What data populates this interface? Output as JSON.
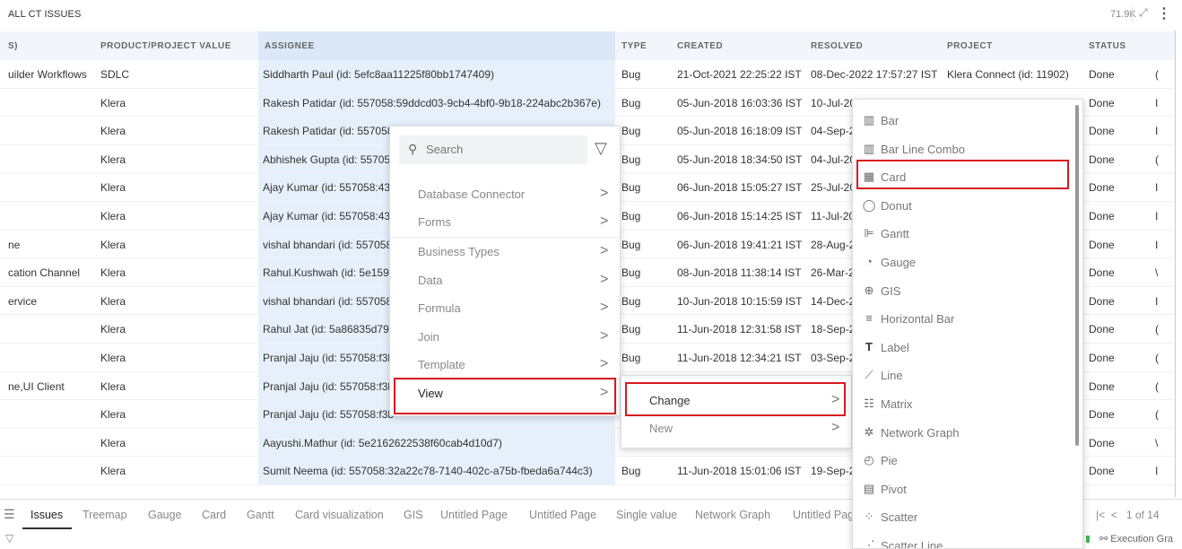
{
  "header": {
    "title": "ALL CT ISSUES",
    "count": "71.9K"
  },
  "table": {
    "columns": [
      "S)",
      "PRODUCT/PROJECT VALUE",
      "ASSIGNEE",
      "TYPE",
      "CREATED",
      "RESOLVED",
      "PROJECT",
      "STATUS"
    ],
    "rows": [
      [
        "uilder Workflows",
        "SDLC",
        "Siddharth Paul (id: 5efc8aa11225f80bb1747409)",
        "Bug",
        "21-Oct-2021 22:25:22 IST",
        "08-Dec-2022 17:57:27 IST",
        "Klera Connect (id: 11902)",
        "Done",
        "("
      ],
      [
        "",
        "Klera",
        "Rakesh Patidar (id: 557058:59ddcd03-9cb4-4bf0-9b18-224abc2b367e)",
        "Bug",
        "05-Jun-2018 16:03:36 IST",
        "10-Jul-20",
        "",
        "Done",
        "I"
      ],
      [
        "",
        "Klera",
        "Rakesh Patidar (id: 557058",
        "Bug",
        "05-Jun-2018 16:18:09 IST",
        "04-Sep-2",
        "",
        "Done",
        "I"
      ],
      [
        "",
        "Klera",
        "Abhishek Gupta (id: 55705",
        "Bug",
        "05-Jun-2018 18:34:50 IST",
        "04-Jul-20",
        "",
        "Done",
        "("
      ],
      [
        "",
        "Klera",
        "Ajay Kumar (id: 557058:43",
        "Bug",
        "06-Jun-2018 15:05:27 IST",
        "25-Jul-20",
        "",
        "Done",
        "I"
      ],
      [
        "",
        "Klera",
        "Ajay Kumar (id: 557058:43",
        "Bug",
        "06-Jun-2018 15:14:25 IST",
        "11-Jul-20",
        "",
        "Done",
        "I"
      ],
      [
        "ne",
        "Klera",
        "vishal bhandari (id: 557058",
        "Bug",
        "06-Jun-2018 19:41:21 IST",
        "28-Aug-2",
        "",
        "Done",
        "I"
      ],
      [
        "cation Channel",
        "Klera",
        "Rahul.Kushwah (id: 5e159c",
        "Bug",
        "08-Jun-2018 11:38:14 IST",
        "26-Mar-2",
        "",
        "Done",
        "\\"
      ],
      [
        "ervice",
        "Klera",
        "vishal bhandari (id: 557058",
        "Bug",
        "10-Jun-2018 10:15:59 IST",
        "14-Dec-2",
        "",
        "Done",
        "I"
      ],
      [
        "",
        "Klera",
        "Rahul Jat (id: 5a86835d79",
        "Bug",
        "11-Jun-2018 12:31:58 IST",
        "18-Sep-2",
        "",
        "Done",
        "("
      ],
      [
        "",
        "Klera",
        "Pranjal Jaju (id: 557058:f3b",
        "Bug",
        "11-Jun-2018 12:34:21 IST",
        "03-Sep-2",
        "",
        "Done",
        "("
      ],
      [
        "ne,UI Client",
        "Klera",
        "Pranjal Jaju (id: 557058:f3b",
        "",
        "",
        "",
        "",
        "Done",
        "("
      ],
      [
        "",
        "Klera",
        "Pranjal Jaju (id: 557058:f3b",
        "",
        "",
        "",
        "",
        "Done",
        "("
      ],
      [
        "",
        "Klera",
        "Aayushi.Mathur (id: 5e2162622538f60cab4d10d7)",
        "",
        "",
        "",
        "",
        "Done",
        "\\"
      ],
      [
        "",
        "Klera",
        "Sumit Neema (id: 557058:32a22c78-7140-402c-a75b-fbeda6a744c3)",
        "Bug",
        "11-Jun-2018 15:01:06 IST",
        "19-Sep-2",
        "",
        "Done",
        "I"
      ]
    ]
  },
  "context_menu": {
    "search_placeholder": "Search",
    "items": [
      "Database Connector",
      "Forms",
      "Business Types",
      "Data",
      "Formula",
      "Join",
      "Template",
      "View"
    ]
  },
  "view_submenu": {
    "items": [
      "Change",
      "New"
    ]
  },
  "change_submenu": {
    "items": [
      {
        "label": "Bar",
        "icon": "bar-chart-icon"
      },
      {
        "label": "Bar Line Combo",
        "icon": "bar-line-combo-icon"
      },
      {
        "label": "Card",
        "icon": "card-grid-icon"
      },
      {
        "label": "Donut",
        "icon": "donut-icon"
      },
      {
        "label": "Gantt",
        "icon": "gantt-icon"
      },
      {
        "label": "Gauge",
        "icon": "gauge-icon"
      },
      {
        "label": "GIS",
        "icon": "globe-icon"
      },
      {
        "label": "Horizontal Bar",
        "icon": "horizontal-bar-icon"
      },
      {
        "label": "Label",
        "icon": "text-t-icon"
      },
      {
        "label": "Line",
        "icon": "line-chart-icon"
      },
      {
        "label": "Matrix",
        "icon": "matrix-icon"
      },
      {
        "label": "Network Graph",
        "icon": "network-graph-icon"
      },
      {
        "label": "Pie",
        "icon": "pie-icon"
      },
      {
        "label": "Pivot",
        "icon": "pivot-table-icon"
      },
      {
        "label": "Scatter",
        "icon": "scatter-icon"
      },
      {
        "label": "Scatter Line",
        "icon": "scatter-line-icon"
      }
    ]
  },
  "tabs": {
    "items": [
      "Issues",
      "Treemap",
      "Gauge",
      "Card",
      "Gantt",
      "Card visualization",
      "GIS",
      "Untitled Page",
      "Untitled Page",
      "Single value",
      "Network Graph",
      "Untitled Pag"
    ],
    "active": "Issues",
    "pager": "1 of 14"
  },
  "footer": {
    "exec_label": "Execution Gra"
  },
  "colors": {
    "highlight": "#d71920",
    "assignee_bg": "#e6f0fb",
    "header_bg": "#f2f6fc"
  }
}
